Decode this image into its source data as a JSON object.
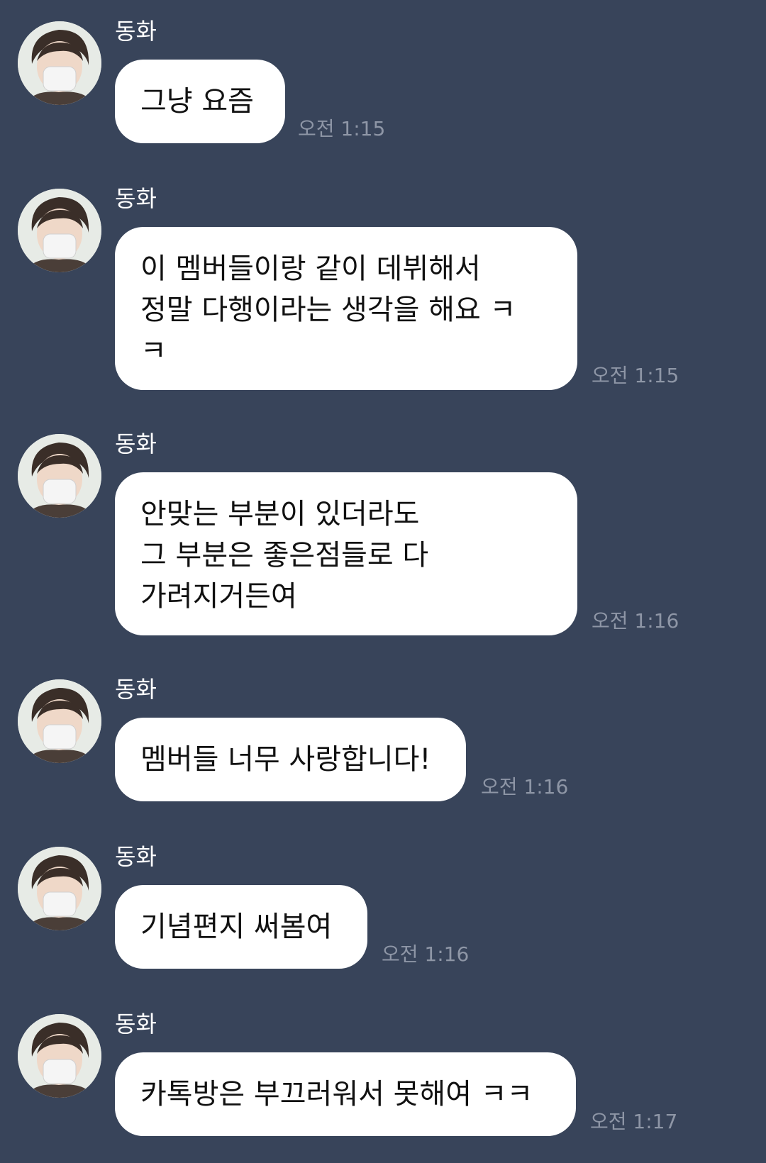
{
  "messages": [
    {
      "sender": "동화",
      "text": "그냥 요즘",
      "time": "오전 1:15"
    },
    {
      "sender": "동화",
      "text": "이 멤버들이랑 같이 데뷔해서\n정말 다행이라는 생각을 해요 ㅋ\nㅋ",
      "time": "오전 1:15"
    },
    {
      "sender": "동화",
      "text": "안맞는 부분이 있더라도\n그 부분은 좋은점들로 다\n가려지거든여",
      "time": "오전 1:16"
    },
    {
      "sender": "동화",
      "text": "멤버들 너무 사랑합니다!",
      "time": "오전 1:16"
    },
    {
      "sender": "동화",
      "text": "기념편지 써봄여",
      "time": "오전 1:16"
    },
    {
      "sender": "동화",
      "text": "카톡방은 부끄러워서 못해여 ㅋㅋ",
      "time": "오전 1:17"
    }
  ],
  "colors": {
    "background": "#38445a",
    "bubble": "#ffffff",
    "timestamp": "#8e96a6",
    "sender": "#ffffff"
  },
  "icons": {
    "avatar": "profile-photo-avatar-icon"
  }
}
